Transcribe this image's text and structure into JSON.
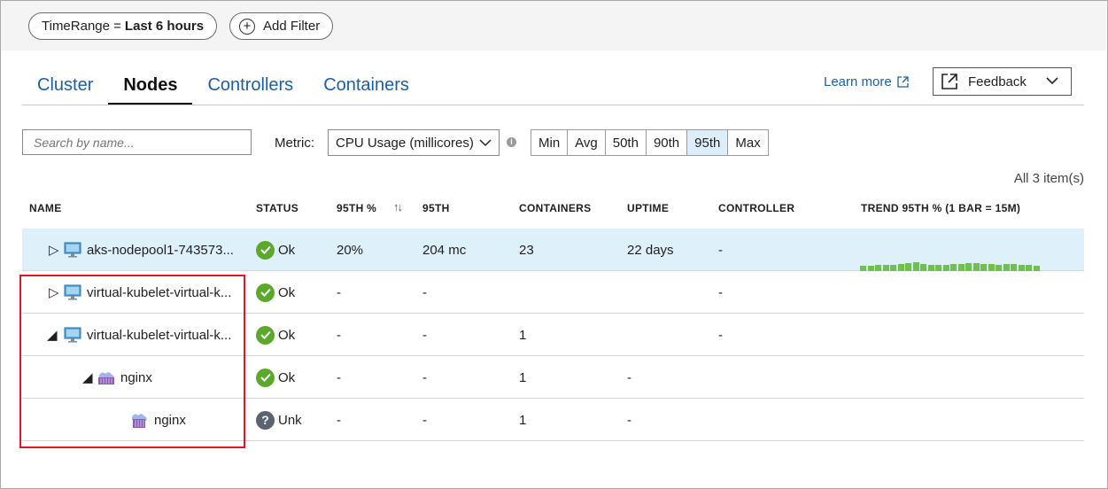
{
  "filters": {
    "timerange_key": "TimeRange =",
    "timerange_value": "Last 6 hours",
    "add_filter": "Add Filter"
  },
  "tabs": [
    {
      "label": "Cluster"
    },
    {
      "label": "Nodes"
    },
    {
      "label": "Controllers"
    },
    {
      "label": "Containers"
    }
  ],
  "header_links": {
    "learn_more": "Learn more",
    "feedback": "Feedback"
  },
  "toolbar": {
    "search_placeholder": "Search by name...",
    "metric_label": "Metric:",
    "metric_value": "CPU Usage (millicores)",
    "percentiles": [
      "Min",
      "Avg",
      "50th",
      "90th",
      "95th",
      "Max"
    ],
    "selected_percentile": "95th",
    "item_count": "All 3 item(s)"
  },
  "columns": {
    "name": "NAME",
    "status": "STATUS",
    "pct95": "95TH %",
    "p95": "95TH",
    "containers": "CONTAINERS",
    "uptime": "UPTIME",
    "controller": "CONTROLLER",
    "trend": "TREND 95TH % (1 BAR = 15M)"
  },
  "rows": [
    {
      "expander": "▷",
      "name": "aks-nodepool1-743573...",
      "status": "Ok",
      "pct": "20%",
      "p95": "204 mc",
      "containers": "23",
      "uptime": "22 days",
      "controller": "-"
    },
    {
      "expander": "▷",
      "name": "virtual-kubelet-virtual-k...",
      "status": "Ok",
      "pct": "-",
      "p95": "-",
      "containers": "",
      "uptime": "",
      "controller": "-"
    },
    {
      "expander": "◢",
      "name": "virtual-kubelet-virtual-k...",
      "status": "Ok",
      "pct": "-",
      "p95": "-",
      "containers": "1",
      "uptime": "",
      "controller": "-"
    },
    {
      "expander": "◢",
      "name": "nginx",
      "status": "Ok",
      "pct": "-",
      "p95": "-",
      "containers": "1",
      "uptime": "-",
      "controller": ""
    },
    {
      "expander": "",
      "name": "nginx",
      "status": "Unk",
      "pct": "-",
      "p95": "-",
      "containers": "1",
      "uptime": "-",
      "controller": ""
    }
  ],
  "trend_levels": [
    0.6,
    0.6,
    0.7,
    0.7,
    0.7,
    0.8,
    0.9,
    1.0,
    0.8,
    0.7,
    0.7,
    0.7,
    0.8,
    0.8,
    0.9,
    0.9,
    0.8,
    0.8,
    0.7,
    0.8,
    0.8,
    0.7,
    0.7,
    0.6
  ],
  "colors": {
    "link_blue": "#1a5fa8",
    "ok_green": "#5aa928",
    "trend_green": "#6cc24a",
    "selected_row": "#def0fa",
    "highlight_red": "#e0171f"
  }
}
